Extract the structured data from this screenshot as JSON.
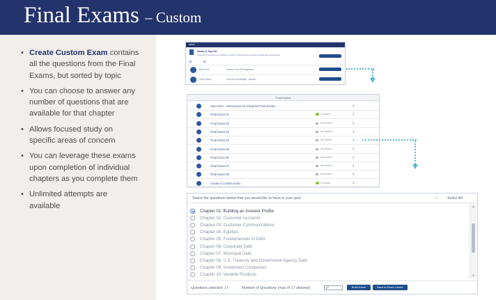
{
  "slide": {
    "title": "Final Exams",
    "subtitle": "– Custom"
  },
  "bullets": [
    {
      "lead": "Create Custom Exam",
      "text": " contains all the questions from the Final Exams, but sorted by topic"
    },
    {
      "lead": "",
      "text": "You can choose to answer any number of questions that are available for that chapter"
    },
    {
      "lead": "",
      "text": "Allows focused study on specific areas of concern"
    },
    {
      "lead": "",
      "text": "You can leverage these exams upon completion of individual chapters as you complete them"
    },
    {
      "lead": "",
      "text": "Unlimited attempts are available"
    }
  ],
  "course_panel": {
    "header": "series",
    "course_title": "Series 6 Top Off",
    "course_desc": "Investment Company and Variable Contracts Products Representative Qualification Examination",
    "rows": [
      {
        "label": "Start Here",
        "desc": "Series 6 Top Off Readiness"
      },
      {
        "label": "Final Exams",
        "desc": "Test your knowledge - quizzes"
      }
    ]
  },
  "final_exams": {
    "header": "Final Exams",
    "rows": [
      {
        "label": "Start Here - Instructions for Using the Final Exams",
        "status": "",
        "state": "none"
      },
      {
        "label": "Final Exam 01",
        "status": "Complete",
        "state": "done"
      },
      {
        "label": "Final Exam 02",
        "status": "Not Started",
        "state": "todo"
      },
      {
        "label": "Final Exam 03",
        "status": "Not Started",
        "state": "todo"
      },
      {
        "label": "Final Exam 04",
        "status": "Not Started",
        "state": "todo"
      },
      {
        "label": "Final Exam 05",
        "status": "Not Started",
        "state": "todo"
      },
      {
        "label": "Final Exam 06",
        "status": "Not Started",
        "state": "todo"
      },
      {
        "label": "Final Exam 07",
        "status": "Not Started",
        "state": "todo"
      },
      {
        "label": "Final Exam 08",
        "status": "Not Started",
        "state": "todo"
      },
      {
        "label": "Create a Custom Exam",
        "status": "Complete",
        "state": "done"
      }
    ],
    "chevron": "›"
  },
  "custom_quiz": {
    "prompt": "Select the questions below that you would like to have in your quiz:",
    "close_glyph": "×",
    "select_all": "Select All",
    "chapters": [
      {
        "label": "Chapter 01: Building an Investor Profile",
        "checked": true
      },
      {
        "label": "Chapter 02: Customer Accounts",
        "checked": false
      },
      {
        "label": "Chapter 03: Customer Communications",
        "checked": false
      },
      {
        "label": "Chapter 04: Equities",
        "checked": false
      },
      {
        "label": "Chapter 05: Fundamentals of Debt",
        "checked": false
      },
      {
        "label": "Chapter 06: Corporate Debt",
        "checked": false
      },
      {
        "label": "Chapter 07: Municipal Debt",
        "checked": false
      },
      {
        "label": "Chapter 08: U.S. Treasury and Government Agency Debt",
        "checked": false
      },
      {
        "label": "Chapter 09: Investment Companies",
        "checked": false
      },
      {
        "label": "Chapter 10: Variable Products",
        "checked": false
      }
    ],
    "questions_selected": "Questions selected: 17",
    "num_questions_label": "Number of Questions (max of 17 allowed):",
    "num_questions_value": "17",
    "build_exam": "Build Exam",
    "back": "Back to Exam Center",
    "scroll_up": "▲",
    "scroll_down": "▼"
  }
}
